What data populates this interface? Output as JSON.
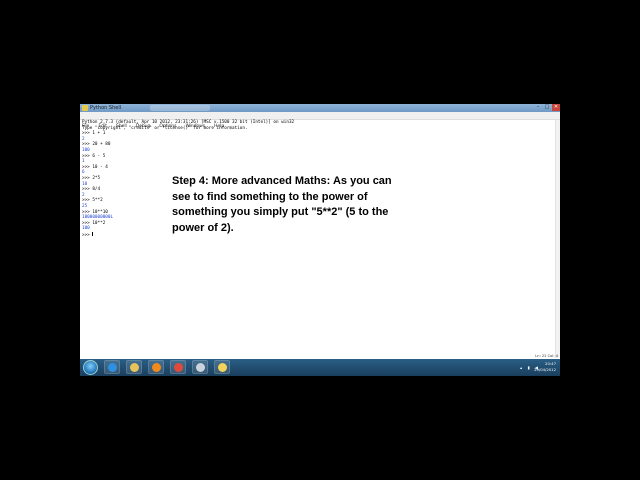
{
  "window": {
    "title": "Python Shell",
    "controls": [
      "–",
      "□",
      "✕"
    ]
  },
  "menu": [
    "File",
    "Edit",
    "Shell",
    "Debug",
    "Options",
    "Windows",
    "Help"
  ],
  "shell": {
    "lines": [
      {
        "text": "Python 2.7.3 (default, Apr 10 2012, 23:31:26) [MSC v.1500 32 bit (Intel)] on win32",
        "kind": "info"
      },
      {
        "text": "Type \"copyright\", \"credits\" or \"license()\" for more information.",
        "kind": "info"
      },
      {
        "text": ">>> 1 + 1",
        "kind": "in"
      },
      {
        "text": "2",
        "kind": "out"
      },
      {
        "text": ">>> 20 + 80",
        "kind": "in"
      },
      {
        "text": "100",
        "kind": "out"
      },
      {
        "text": ">>> 6 - 5",
        "kind": "in"
      },
      {
        "text": "1",
        "kind": "out"
      },
      {
        "text": ">>> 10 - 4",
        "kind": "in"
      },
      {
        "text": "6",
        "kind": "out"
      },
      {
        "text": ">>> 2*5",
        "kind": "in"
      },
      {
        "text": "10",
        "kind": "out"
      },
      {
        "text": ">>> 8/4",
        "kind": "in"
      },
      {
        "text": "2",
        "kind": "out"
      },
      {
        "text": ">>> 5**2",
        "kind": "in"
      },
      {
        "text": "25",
        "kind": "out"
      },
      {
        "text": ">>> 10**10",
        "kind": "in"
      },
      {
        "text": "10000000000L",
        "kind": "out"
      },
      {
        "text": ">>> 10**2",
        "kind": "in"
      },
      {
        "text": "100",
        "kind": "out"
      },
      {
        "text": ">>> ",
        "kind": "prompt"
      }
    ]
  },
  "caption": "Step 4: More advanced Maths: As you can\nsee to find something to the power of\nsomething you simply put \"5**2\" (5 to the\npower of 2).",
  "status_bar": "Ln: 22 Col: 4",
  "taskbar": {
    "buttons": [
      {
        "icon": "internet-explorer-icon",
        "color": "#2f8fe0"
      },
      {
        "icon": "folder-icon",
        "color": "#e8c25a"
      },
      {
        "icon": "media-player-icon",
        "color": "#f08a1c"
      },
      {
        "icon": "chrome-icon",
        "color": "#e04a3a"
      },
      {
        "icon": "network-icon",
        "color": "#c9d3dc"
      },
      {
        "icon": "python-icon",
        "color": "#f3d35b"
      }
    ],
    "clock_time": "20:47",
    "clock_date": "29/04/2012"
  }
}
